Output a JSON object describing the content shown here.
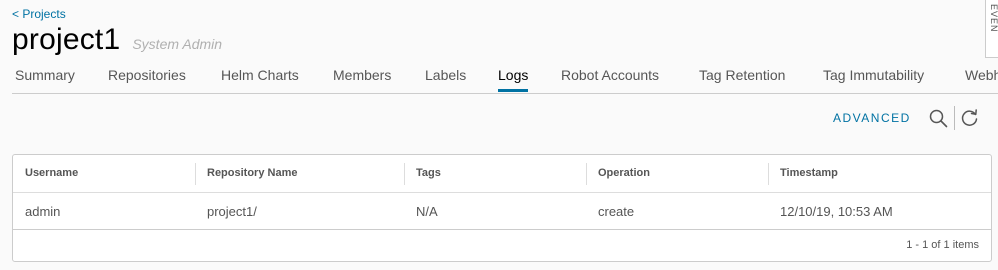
{
  "nav": {
    "back_label": "< Projects"
  },
  "header": {
    "title": "project1",
    "role": "System Admin",
    "side_tab_label": "EVEN"
  },
  "tabs": [
    {
      "label": "Summary"
    },
    {
      "label": "Repositories"
    },
    {
      "label": "Helm Charts"
    },
    {
      "label": "Members"
    },
    {
      "label": "Labels"
    },
    {
      "label": "Logs",
      "active": true
    },
    {
      "label": "Robot Accounts"
    },
    {
      "label": "Tag Retention"
    },
    {
      "label": "Tag Immutability"
    },
    {
      "label": "Webhooks"
    }
  ],
  "toolbar": {
    "advanced_label": "ADVANCED",
    "search_icon": "search-icon",
    "refresh_icon": "refresh-icon"
  },
  "table": {
    "columns": [
      "Username",
      "Repository Name",
      "Tags",
      "Operation",
      "Timestamp"
    ],
    "rows": [
      [
        "admin",
        "project1/",
        "N/A",
        "create",
        "12/10/19, 10:53 AM"
      ]
    ],
    "footer": "1 - 1 of 1 items"
  },
  "colors": {
    "accent": "#0072a3",
    "background": "#fafafa"
  }
}
